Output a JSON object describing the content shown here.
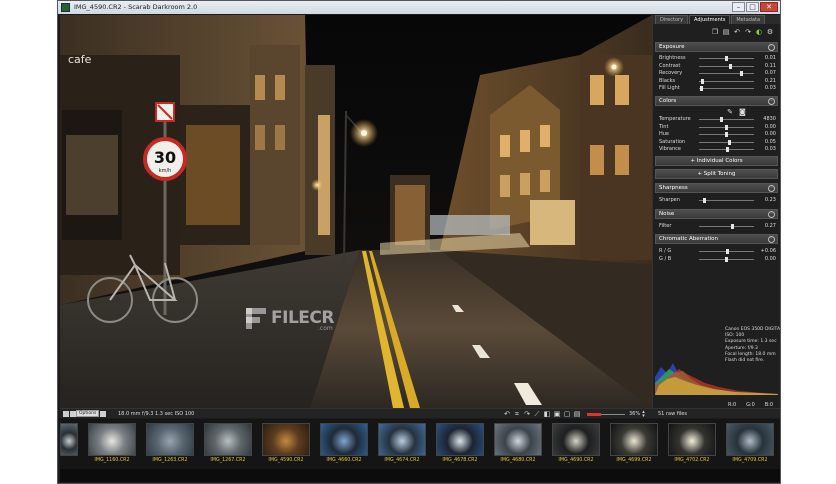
{
  "window": {
    "title": "IMG_4590.CR2 - Scarab Darkroom 2.0",
    "controls": [
      "–",
      "□",
      "✕"
    ]
  },
  "panel": {
    "tabs": [
      "Directory",
      "Adjustments",
      "Metadata"
    ],
    "active_tab": 1,
    "sections": {
      "exposure": {
        "title": "Exposure",
        "rows": [
          {
            "label": "Brightness",
            "value": "0.01",
            "level": 0.5
          },
          {
            "label": "Contrast",
            "value": "0.11",
            "level": 0.58
          },
          {
            "label": "Recovery",
            "value": "0.07",
            "level": 0.78
          },
          {
            "label": "Blacks",
            "value": "0.21",
            "level": 0.06
          },
          {
            "label": "Fill Light",
            "value": "0.03",
            "level": 0.05
          }
        ]
      },
      "colors": {
        "title": "Colors",
        "rows": [
          {
            "label": "Temperature",
            "value": "4830",
            "level": 0.4
          },
          {
            "label": "Tint",
            "value": "0.00",
            "level": 0.5
          },
          {
            "label": "Hue",
            "value": "0.00",
            "level": 0.5
          },
          {
            "label": "Saturation",
            "value": "0.05",
            "level": 0.55
          },
          {
            "label": "Vibrance",
            "value": "0.03",
            "level": 0.52
          }
        ],
        "individual_colors": "+ Individual Colors",
        "split_toning": "+ Split Toning"
      },
      "sharpness": {
        "title": "Sharpness",
        "rows": [
          {
            "label": "Sharpen",
            "value": "0.23",
            "level": 0.1
          }
        ]
      },
      "noise": {
        "title": "Noise",
        "rows": [
          {
            "label": "Filter",
            "value": "0.27",
            "level": 0.6
          }
        ]
      },
      "chromatic": {
        "title": "Chromatic Aberration",
        "rows": [
          {
            "label": "R / G",
            "value": "+0.06",
            "level": 0.52
          },
          {
            "label": "G / B",
            "value": "0.00",
            "level": 0.5
          }
        ]
      }
    },
    "exif": [
      "Canon EOS 350D DIGITAL",
      "ISO: 100",
      "Exposure time: 1.3 sec",
      "Aperture: f/9.3",
      "Focal length: 18.0 mm",
      "Flash did not fire."
    ],
    "histogram_labels": [
      "R:0",
      "G:0",
      "B:0"
    ]
  },
  "infostrip": {
    "options_label": "Options",
    "meta": "18.0 mm   f/9.3   1.3 sec   ISO 100",
    "zoom_value": "36%",
    "zoom_level": 0.36,
    "file_count": "51 raw files"
  },
  "filmstrip": {
    "items": [
      {
        "label": "",
        "palette": [
          "#5c6a74",
          "#c9cdd0",
          "#2a2f33"
        ]
      },
      {
        "label": "IMG_1160.CR2",
        "palette": [
          "#3a3f44",
          "#e8e6e0",
          "#7a7f84"
        ]
      },
      {
        "label": "IMG_1263.CR2",
        "palette": [
          "#2d3842",
          "#9aa6ad",
          "#596670"
        ]
      },
      {
        "label": "IMG_1267.CR2",
        "palette": [
          "#30363a",
          "#b8bfc3",
          "#60676b"
        ]
      },
      {
        "label": "IMG_4590.CR2",
        "palette": [
          "#2a1c12",
          "#c48a3e",
          "#5d3d20"
        ]
      },
      {
        "label": "IMG_4660.CR2",
        "palette": [
          "#2f5f9a",
          "#7fa6cf",
          "#1f2a36"
        ]
      },
      {
        "label": "IMG_4674.CR2",
        "palette": [
          "#3f6d9c",
          "#b9cde0",
          "#26323e"
        ]
      },
      {
        "label": "IMG_4678.CR2",
        "palette": [
          "#2b5082",
          "#dbe3ea",
          "#1b2430"
        ]
      },
      {
        "label": "IMG_4680.CR2",
        "palette": [
          "#6d7680",
          "#cfd6dc",
          "#3b434b"
        ]
      },
      {
        "label": "IMG_4690.CR2",
        "palette": [
          "#3b3d3e",
          "#d6d3c8",
          "#1e1f20"
        ]
      },
      {
        "label": "IMG_4699.CR2",
        "palette": [
          "#101214",
          "#ece6d0",
          "#3a3a34"
        ]
      },
      {
        "label": "IMG_4702.CR2",
        "palette": [
          "#121416",
          "#f4efdc",
          "#33332e"
        ]
      },
      {
        "label": "IMG_4709.CR2",
        "palette": [
          "#4b5a66",
          "#aebdc8",
          "#27323a"
        ]
      }
    ]
  },
  "watermark": {
    "text": "FILECR",
    "sub": ".com"
  },
  "photo": {
    "sign_speed": "30",
    "sign_unit": "km/h",
    "shop_text": "cafe"
  }
}
